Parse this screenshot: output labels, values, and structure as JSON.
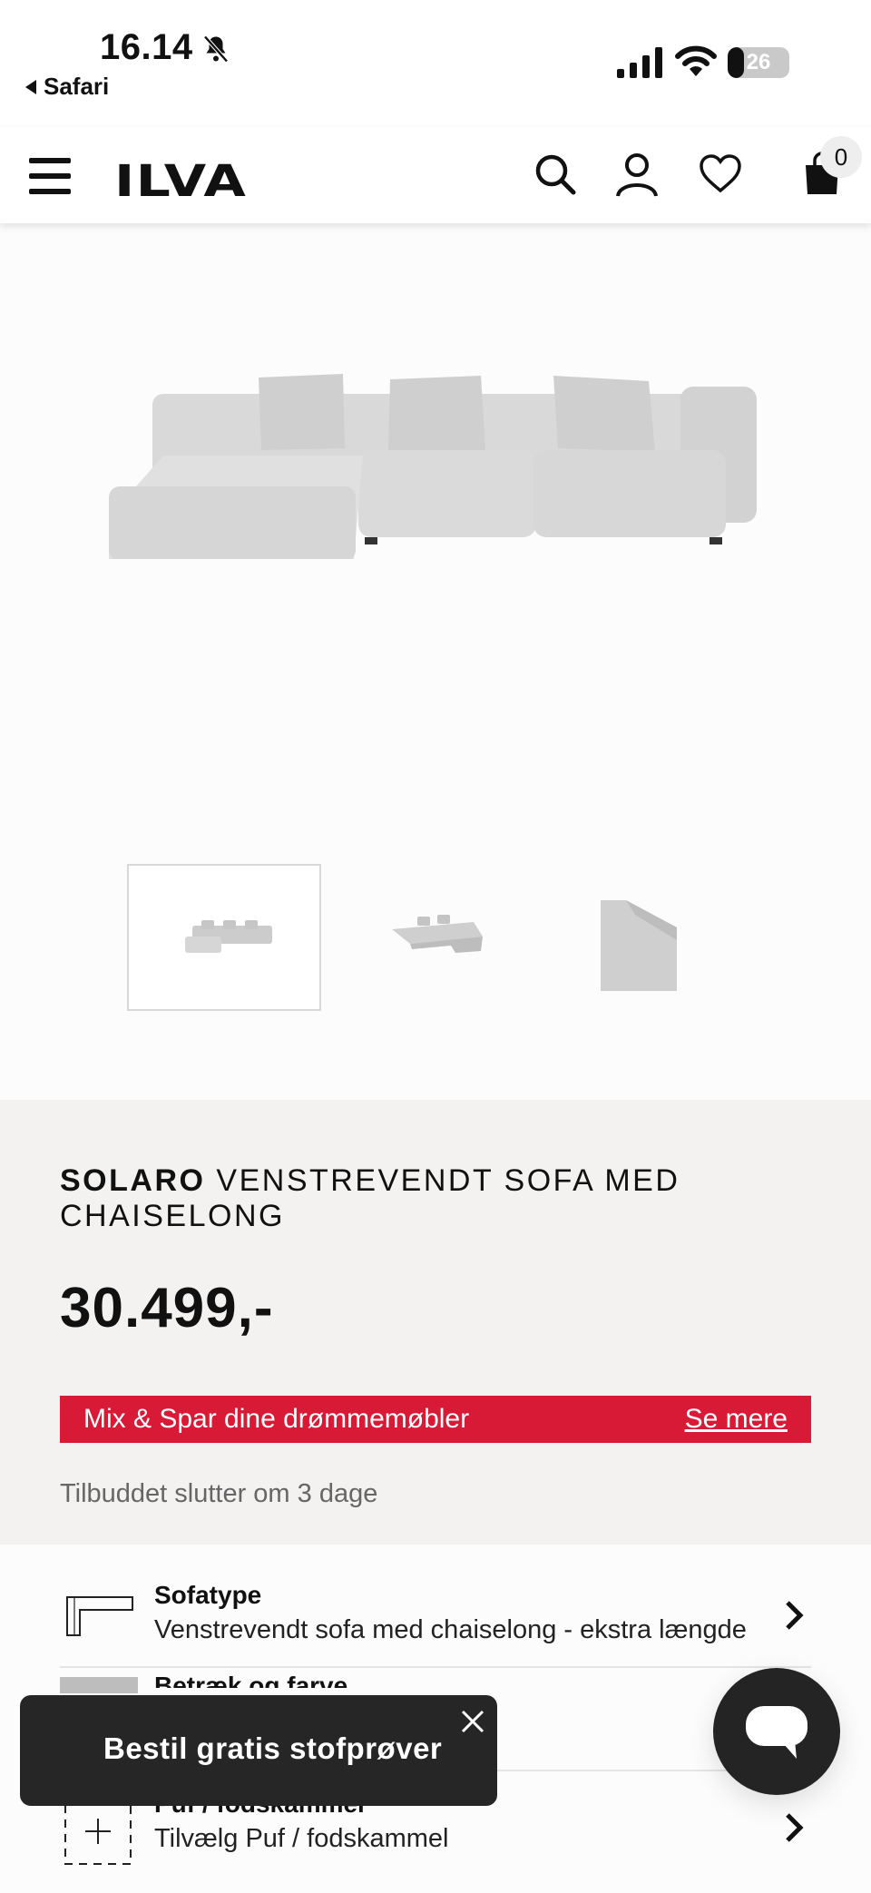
{
  "status_bar": {
    "time": "16.14",
    "back_app": "Safari",
    "battery": "26",
    "battery_level": 0.26
  },
  "header": {
    "logo": "ILVA",
    "cart_count": "0",
    "icons": [
      "menu-icon",
      "search-icon",
      "account-icon",
      "heart-icon",
      "shopping-bag-icon"
    ]
  },
  "gallery": {
    "thumbnails": [
      "sofa-front-thumbnail",
      "sofa-angled-thumbnail",
      "sofa-detail-thumbnail"
    ],
    "selected_index": 0
  },
  "product": {
    "brand": "SOLARO",
    "name": "VENSTREVENDT SOFA MED CHAISELONG",
    "price": "30.499,-"
  },
  "promo": {
    "text": "Mix & Spar dine drømmemøbler",
    "link": "Se mere",
    "color": "#d91a36"
  },
  "offer_note": "Tilbuddet slutter om 3 dage",
  "options": [
    {
      "title": "Sofatype",
      "value": "Venstrevendt sofa med chaiselong - ekstra længde"
    },
    {
      "title": "Betræk og farve",
      "value": ""
    },
    {
      "title": "Puf / fodskammel",
      "value": "Tilvælg Puf / fodskammel"
    }
  ],
  "toast": {
    "text": "Bestil gratis stofprøver"
  }
}
